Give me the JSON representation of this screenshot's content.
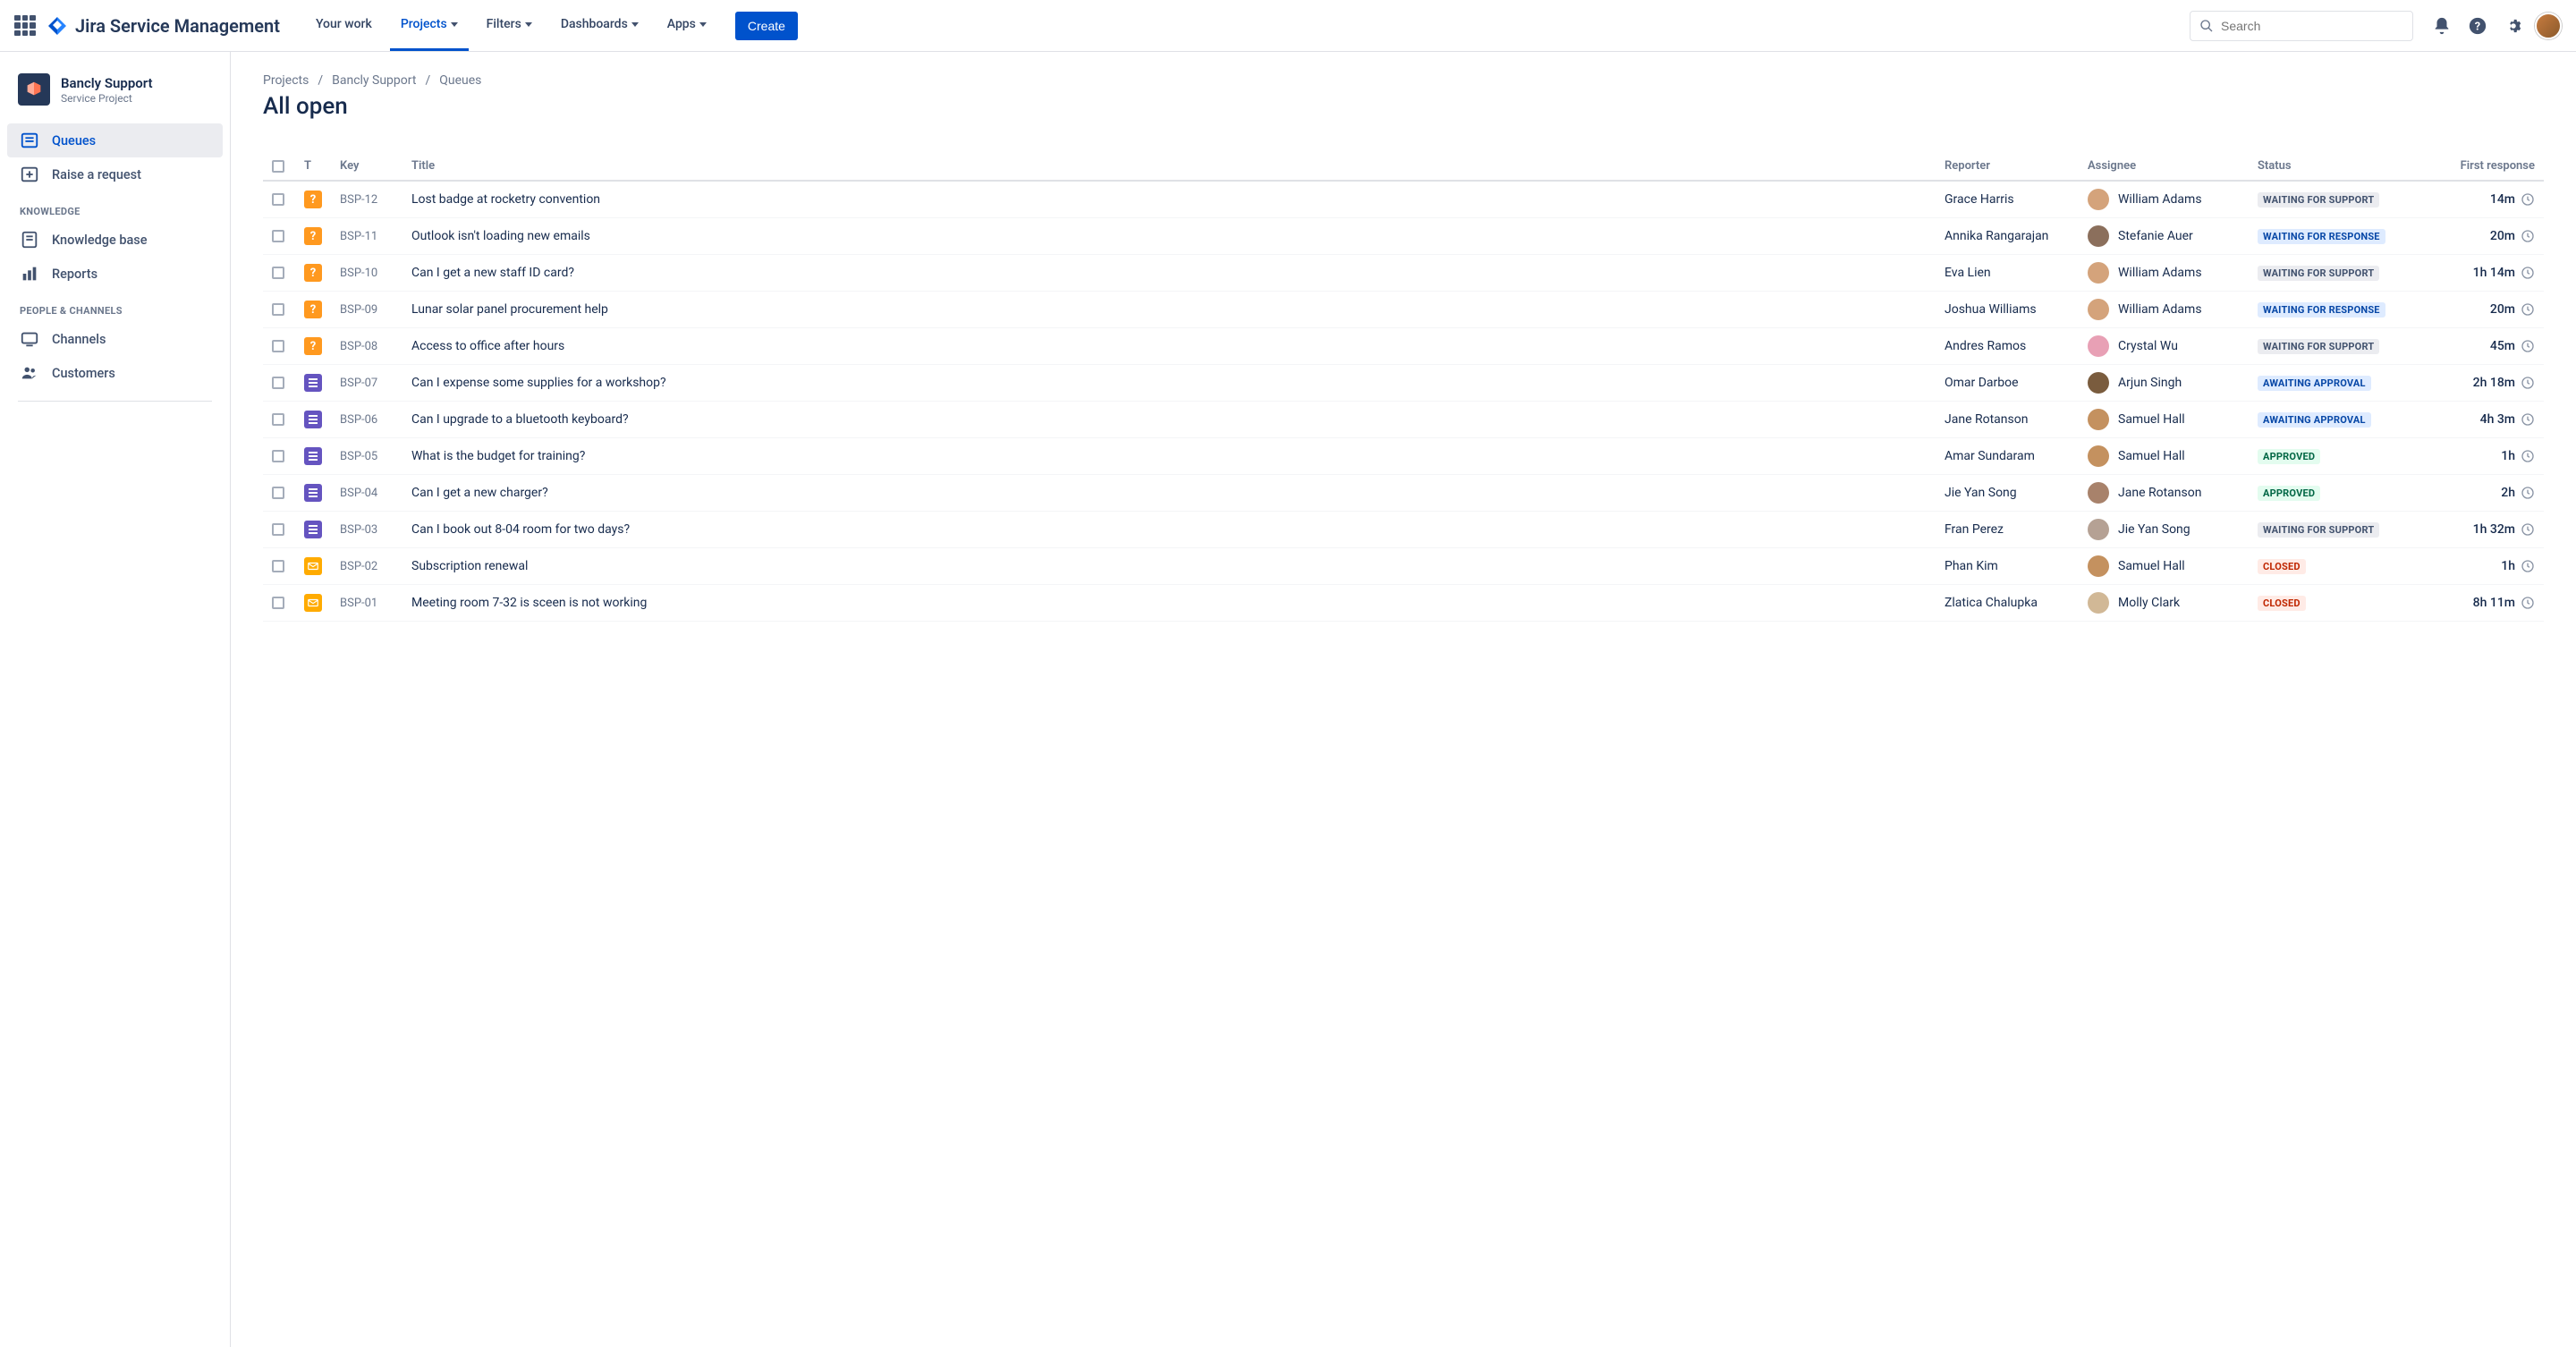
{
  "product_name": "Jira Service Management",
  "nav": {
    "your_work": "Your work",
    "projects": "Projects",
    "filters": "Filters",
    "dashboards": "Dashboards",
    "apps": "Apps"
  },
  "create_label": "Create",
  "search_placeholder": "Search",
  "project": {
    "name": "Bancly Support",
    "subtitle": "Service Project"
  },
  "sidebar": {
    "queues": "Queues",
    "raise_request": "Raise a request",
    "knowledge_header": "KNOWLEDGE",
    "knowledge_base": "Knowledge base",
    "reports": "Reports",
    "people_header": "PEOPLE & CHANNELS",
    "channels": "Channels",
    "customers": "Customers"
  },
  "breadcrumb": {
    "projects": "Projects",
    "project": "Bancly Support",
    "section": "Queues"
  },
  "page_title": "All open",
  "columns": {
    "type": "T",
    "key": "Key",
    "title": "Title",
    "reporter": "Reporter",
    "assignee": "Assignee",
    "status": "Status",
    "first_response": "First response"
  },
  "status_labels": {
    "wfs": "WAITING FOR SUPPORT",
    "wfr": "WAITING FOR RESPONSE",
    "aa": "AWAITING APPROVAL",
    "approved": "APPROVED",
    "closed": "CLOSED"
  },
  "rows": [
    {
      "type": "question",
      "key": "BSP-12",
      "title": "Lost badge at rocketry convention",
      "reporter": "Grace Harris",
      "assignee": "William Adams",
      "avatar": "#d4a37b",
      "status": "wfs",
      "resp": "14m"
    },
    {
      "type": "question",
      "key": "BSP-11",
      "title": "Outlook isn't loading new emails",
      "reporter": "Annika Rangarajan",
      "assignee": "Stefanie Auer",
      "avatar": "#8b6f5c",
      "status": "wfr",
      "resp": "20m"
    },
    {
      "type": "question",
      "key": "BSP-10",
      "title": "Can I get a new staff ID card?",
      "reporter": "Eva Lien",
      "assignee": "William Adams",
      "avatar": "#d4a37b",
      "status": "wfs",
      "resp": "1h 14m"
    },
    {
      "type": "question",
      "key": "BSP-09",
      "title": "Lunar solar panel procurement help",
      "reporter": "Joshua Williams",
      "assignee": "William Adams",
      "avatar": "#d4a37b",
      "status": "wfr",
      "resp": "20m"
    },
    {
      "type": "question",
      "key": "BSP-08",
      "title": "Access to office after hours",
      "reporter": "Andres Ramos",
      "assignee": "Crystal Wu",
      "avatar": "#e8a0b5",
      "status": "wfs",
      "resp": "45m"
    },
    {
      "type": "task",
      "key": "BSP-07",
      "title": "Can I expense some supplies for a workshop?",
      "reporter": "Omar Darboe",
      "assignee": "Arjun Singh",
      "avatar": "#7a5c3e",
      "status": "aa",
      "resp": "2h 18m"
    },
    {
      "type": "task",
      "key": "BSP-06",
      "title": "Can I upgrade to a bluetooth keyboard?",
      "reporter": "Jane Rotanson",
      "assignee": "Samuel Hall",
      "avatar": "#c4915f",
      "status": "aa",
      "resp": "4h 3m"
    },
    {
      "type": "task",
      "key": "BSP-05",
      "title": "What is the budget for training?",
      "reporter": "Amar Sundaram",
      "assignee": "Samuel Hall",
      "avatar": "#c4915f",
      "status": "approved",
      "resp": "1h"
    },
    {
      "type": "task",
      "key": "BSP-04",
      "title": "Can I get a new charger?",
      "reporter": "Jie Yan Song",
      "assignee": "Jane Rotanson",
      "avatar": "#a8826b",
      "status": "approved",
      "resp": "2h"
    },
    {
      "type": "task",
      "key": "BSP-03",
      "title": "Can I book out 8-04 room for two days?",
      "reporter": "Fran Perez",
      "assignee": "Jie Yan Song",
      "avatar": "#b5a194",
      "status": "wfs",
      "resp": "1h 32m"
    },
    {
      "type": "email",
      "key": "BSP-02",
      "title": "Subscription renewal",
      "reporter": "Phan Kim",
      "assignee": "Samuel Hall",
      "avatar": "#c4915f",
      "status": "closed",
      "resp": "1h"
    },
    {
      "type": "email",
      "key": "BSP-01",
      "title": "Meeting room 7-32 is sceen is not working",
      "reporter": "Zlatica Chalupka",
      "assignee": "Molly Clark",
      "avatar": "#d1b896",
      "status": "closed",
      "resp": "8h 11m"
    }
  ]
}
